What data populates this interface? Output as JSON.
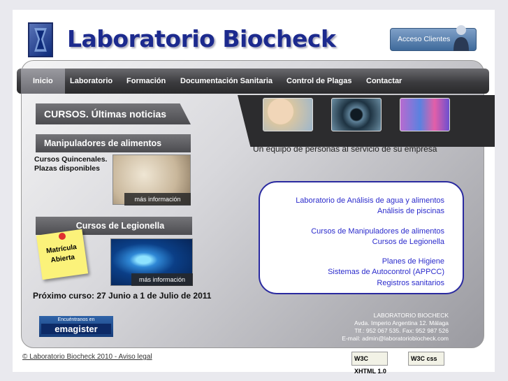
{
  "header": {
    "title": "Laboratorio Biocheck",
    "clients_button": "Acceso Clientes"
  },
  "nav": {
    "items": [
      "Inicio",
      "Laboratorio",
      "Formación",
      "Documentación Sanitaria",
      "Control de Plagas",
      "Contactar"
    ],
    "active": "Inicio"
  },
  "sections": {
    "cursos_title": "CURSOS. Últimas noticias",
    "manipuladores_title": "Manipuladores de alimentos",
    "manipuladores_text": "Cursos Quincenales. Plazas disponibles",
    "legionella_title": "Cursos de Legionella",
    "more_info": "más información",
    "note_text": "Matrícula Abierta",
    "next_course": "Próximo curso: 27 Junio a 1 de Julio de 2011"
  },
  "tagline": "Un equipo de personas al servicio de su empresa",
  "services": [
    "Laboratorio de Análisis de agua y alimentos",
    "Análisis de piscinas",
    "Cursos de Manipuladores de alimentos",
    "Cursos de Legionella",
    "Planes de Higiene",
    "Sistemas de Autocontrol (APPCC)",
    "Registros sanitarios"
  ],
  "emagister": {
    "top": "Encuéntranos en",
    "brand": "emagister"
  },
  "address": {
    "name": "LABORATORIO  BIOCHECK",
    "street": "Avda. Imperio Argentina 12. Málaga",
    "phones": "Tlf.: 952 067 535.   Fax: 952 987 526",
    "email": "E-mail: admin@laboratoriobiocheck.com"
  },
  "footer": {
    "copyright": "© Laboratorio Biocheck 2010 - Aviso legal",
    "badge_xhtml": "W3C XHTML 1.0",
    "badge_css": "W3C css"
  },
  "colors": {
    "title": "#1c2a8e",
    "link": "#2b2bcc",
    "nav": "#3b3b3e"
  }
}
